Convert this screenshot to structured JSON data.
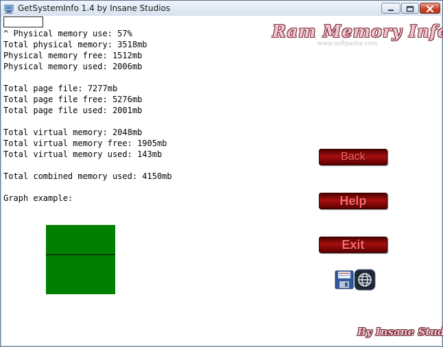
{
  "window": {
    "title": "GetSystemInfo 1.4 by Insane Studios",
    "icon": "computer-icon",
    "controls": [
      "minimize-icon",
      "maximize-icon",
      "close-icon"
    ]
  },
  "header": {
    "logo_text": "Ram Memory Info",
    "watermark": "www.softpedia.com"
  },
  "info_lines": [
    "^ Physical memory use: 57%",
    "Total physical memory: 3518mb",
    "Physical memory free: 1512mb",
    "Physical memory used: 2006mb",
    "",
    "Total page file: 7277mb",
    "Total page file free: 5276mb",
    "Total page file used: 2001mb",
    "",
    "Total virtual memory: 2048mb",
    "Total virtual memory free: 1905mb",
    "Total virtual memory used: 143mb",
    "",
    "Total combined memory used: 4150mb",
    "",
    "Graph example:"
  ],
  "buttons": {
    "back": "Back",
    "help": "Help",
    "exit": "Exit"
  },
  "icons": {
    "save": "save-icon",
    "web": "globe-icon"
  },
  "graph": {
    "fill_color": "#008000",
    "line_color": "#000000",
    "memory_use_percent": 57
  },
  "footer": {
    "brand": "By Insane Studios"
  },
  "colors": {
    "button_text": "#ff6b6b",
    "button_bg": "#a80f0f",
    "logo_fill": "#f2c7cf",
    "logo_outline": "#7a2b38"
  }
}
